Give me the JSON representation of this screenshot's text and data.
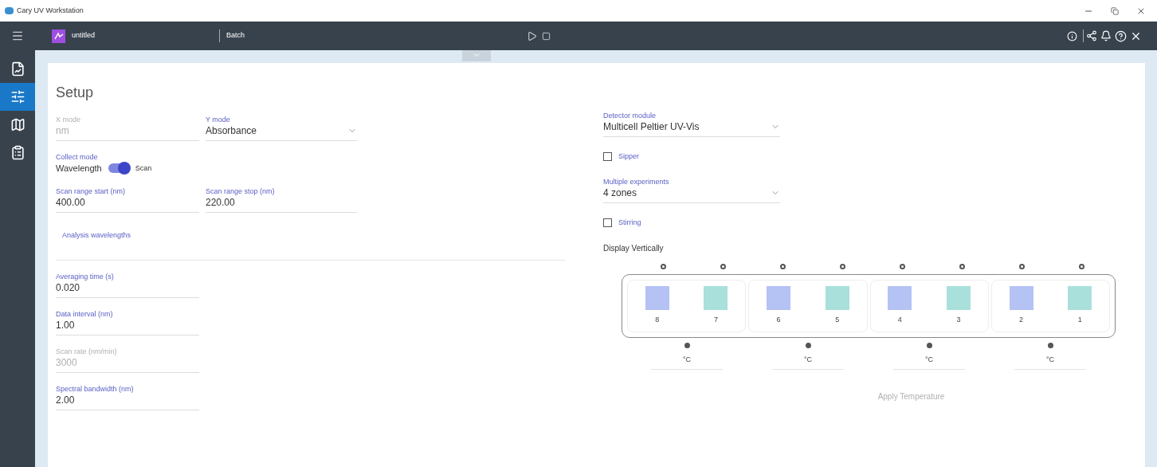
{
  "window": {
    "title": "Cary UV Workstation"
  },
  "toolbar": {
    "document": "untitled",
    "mode": "Batch"
  },
  "sidebar": {
    "items": [
      {
        "kind": "report",
        "selected": false
      },
      {
        "kind": "setup",
        "selected": true
      },
      {
        "kind": "map",
        "selected": false
      },
      {
        "kind": "clipboard",
        "selected": false
      }
    ]
  },
  "setup": {
    "title": "Setup",
    "left": [
      {
        "kind": "pair",
        "fields": [
          {
            "kind": "text",
            "label": "X mode",
            "value": "nm",
            "disabled": true
          },
          {
            "kind": "select",
            "label": "Y mode",
            "value": "Absorbance",
            "disabled": false
          }
        ]
      },
      {
        "kind": "toggle",
        "label": "Collect mode",
        "off_label": "Wavelength",
        "on_label": "Scan",
        "on": true
      },
      {
        "kind": "pair",
        "fields": [
          {
            "kind": "text",
            "label": "Scan range start (nm)",
            "value": "400.00",
            "disabled": false
          },
          {
            "kind": "text",
            "label": "Scan range stop (nm)",
            "value": "220.00",
            "disabled": false
          }
        ]
      },
      {
        "kind": "heading",
        "label": "Analysis wavelengths"
      },
      {
        "kind": "text",
        "label": "Averaging time (s)",
        "value": "0.020",
        "disabled": false
      },
      {
        "kind": "text",
        "label": "Data interval (nm)",
        "value": "1.00",
        "disabled": false
      },
      {
        "kind": "text",
        "label": "Scan rate (nm/min)",
        "value": "3000",
        "disabled": true
      },
      {
        "kind": "text",
        "label": "Spectral bandwidth (nm)",
        "value": "2.00",
        "disabled": false
      }
    ],
    "right": [
      {
        "kind": "select",
        "label": "Detector module",
        "value": "Multicell Peltier UV-Vis",
        "disabled": false
      },
      {
        "kind": "checkbox",
        "label": "Sipper",
        "checked": false
      },
      {
        "kind": "select",
        "label": "Multiple experiments",
        "value": "4 zones",
        "disabled": false
      },
      {
        "kind": "checkbox",
        "label": "Stirring",
        "checked": false
      },
      {
        "kind": "caption",
        "label": "Display Vertically"
      }
    ],
    "cell_holder": {
      "zones": [
        {
          "unit": "°C",
          "cells": [
            {
              "number": "8",
              "color": "#b4c2f4"
            },
            {
              "number": "7",
              "color": "#a9e0dc"
            }
          ]
        },
        {
          "unit": "°C",
          "cells": [
            {
              "number": "6",
              "color": "#b4c2f4"
            },
            {
              "number": "5",
              "color": "#a9e0dc"
            }
          ]
        },
        {
          "unit": "°C",
          "cells": [
            {
              "number": "4",
              "color": "#b4c2f4"
            },
            {
              "number": "3",
              "color": "#a9e0dc"
            }
          ]
        },
        {
          "unit": "°C",
          "cells": [
            {
              "number": "2",
              "color": "#b4c2f4"
            },
            {
              "number": "1",
              "color": "#a9e0dc"
            }
          ]
        }
      ]
    },
    "apply_button": {
      "label": "Apply Temperature",
      "disabled": true
    }
  }
}
